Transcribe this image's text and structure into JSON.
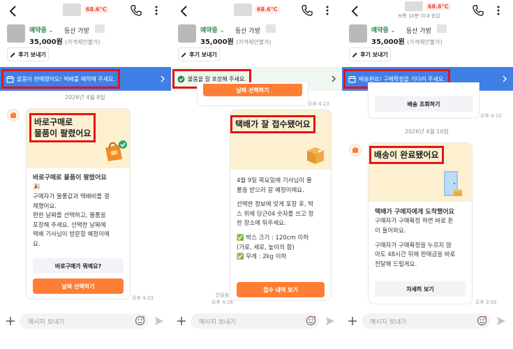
{
  "header": {
    "temperature": "68.6°C",
    "response": "보통 10분 이내 응답"
  },
  "product": {
    "status": "예약중",
    "title": "등산 가방",
    "price": "35,000원",
    "price_note": "(가격제안불가)"
  },
  "review_button": "후기 보내기",
  "input_placeholder": "메시지 보내기",
  "panels": [
    {
      "banner": "물품이 판매됐어요! 택배를 예약해 주세요.",
      "date": "2026년 4월 8일",
      "card_title_line1": "바로구매로",
      "card_title_line2": "물품이 팔렸어요",
      "body_title": "바로구매로 물품이 팔렸어요",
      "body_emoji": "🎉",
      "body_lines": [
        "구매자가 물품값과 택배비를 결",
        "제했어요.",
        "편한 날짜를 선택하고, 물품을",
        "포장해 주세요. 선택한 날짜에",
        "택배 기사님이 방문할 예정이에",
        "요."
      ],
      "btn_secondary": "바로구매가 뭐예요?",
      "btn_primary": "날짜 선택하기",
      "time": "오후 4:23"
    },
    {
      "banner": "물품을 잘 포장해 주세요.",
      "prev_button": "날짜 선택하기",
      "prev_time": "오후 4:23",
      "card_title": "택배가 잘 접수됐어요",
      "body_lines": [
        "4월 9일 목요일에 기사님이 물",
        "품을 받으러 갈 예정이에요.",
        "",
        "선택한 정보에 맞게 포장 후, 박",
        "스 위에 당근04 숫자를 쓰고 정",
        "한 장소에 둬주세요.",
        ""
      ],
      "check_items": [
        "박스 크기 : 120cm 이하",
        "(가로, 세로, 높이의 합)",
        "무게 : 2kg 이하"
      ],
      "btn_primary": "접수 내역 보기",
      "read": "안읽음",
      "time": "오후 4:26"
    },
    {
      "banner": "배송완료! 구매확정을 기다려 주세요.",
      "prev_button": "배송 조회하기",
      "prev_time": "오후 4:10",
      "date": "2026년 4월 10일",
      "card_title": "배송이 완료됐어요",
      "body_title": "택배가 구매자에게 도착했어요",
      "body_lines": [
        "구매자가 구매확정 하면 바로 돈",
        "이 들어와요.",
        "",
        "구매자가 구매확정을 누르지 않",
        "아도 48시간 뒤에 판매금을 바로",
        "전달해 드릴게요."
      ],
      "btn_secondary": "자세히 보기",
      "time": "오후 2:02"
    }
  ],
  "colors": {
    "orange": "#ff7e36",
    "blue_banner": "#3f7fe6",
    "green_banner": "#eef7f0",
    "highlight_red": "#e3141a",
    "card_yellow": "#fdf0d0",
    "temperature": "#e9483b"
  }
}
